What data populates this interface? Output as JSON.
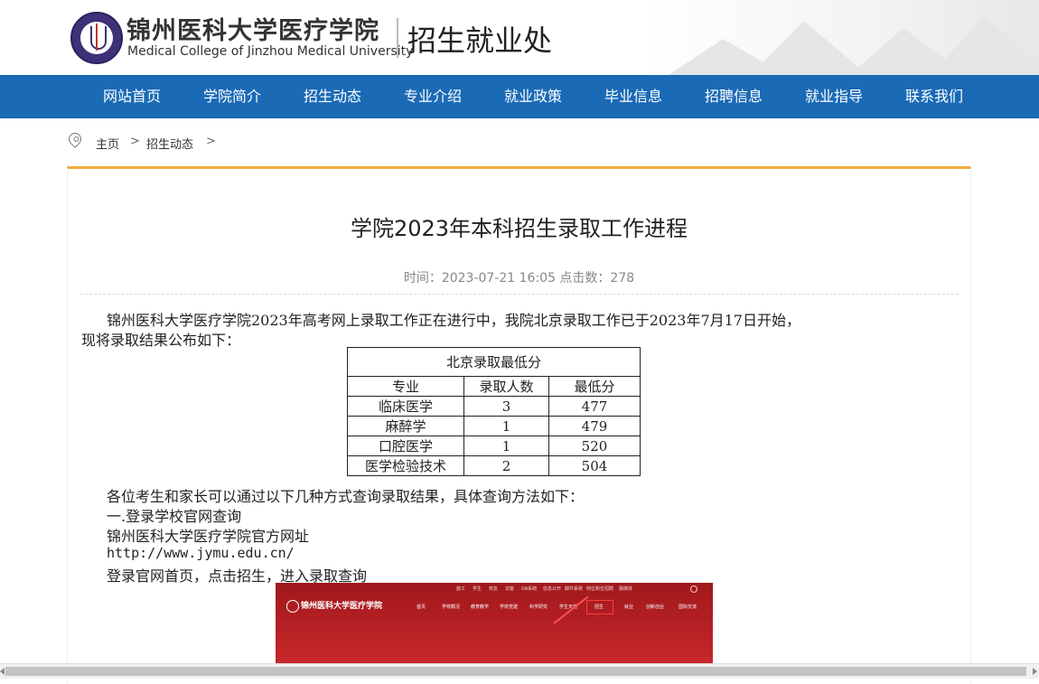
{
  "header": {
    "cn_name": "锦州医科大学医疗学院",
    "en_name": "Medical College of Jinzhou Medical University",
    "dept": "招生就业处"
  },
  "nav": {
    "items": [
      "网站首页",
      "学院简介",
      "招生动态",
      "专业介绍",
      "就业政策",
      "毕业信息",
      "招聘信息",
      "就业指导",
      "联系我们"
    ],
    "color": "#1a6ab6"
  },
  "breadcrumb": {
    "home": "主页",
    "sep": ">",
    "section": "招生动态",
    "sep2": ">"
  },
  "article": {
    "title": "学院2023年本科招生录取工作进程",
    "meta": "时间：2023-07-21 16:05 点击数：278",
    "para1_line1": "锦州医科大学医疗学院2023年高考网上录取工作正在进行中，我院北京录取工作已于2023年7月17日开始，",
    "para1_line2": "现将录取结果公布如下：",
    "table": {
      "caption": "北京录取最低分",
      "headers": [
        "专业",
        "录取人数",
        "最低分"
      ],
      "rows": [
        [
          "临床医学",
          "3",
          "477"
        ],
        [
          "麻醉学",
          "1",
          "479"
        ],
        [
          "口腔医学",
          "1",
          "520"
        ],
        [
          "医学检验技术",
          "2",
          "504"
        ]
      ]
    },
    "para2": "各位考生和家长可以通过以下几种方式查询录取结果，具体查询方法如下：",
    "para3": "一.登录学校官网查询",
    "para4": "锦州医科大学医疗学院官方网址",
    "para5": "http://www.jymu.edu.cn/",
    "para6": "登录官网首页，点击招生，进入录取查询"
  },
  "screenshot": {
    "school_name": "锦州医科大学医疗学院",
    "top_links": [
      "施工",
      "学生",
      "校友",
      "访客",
      "OA系统",
      "信息公开",
      "邮件系统",
      "岗位和位招聘",
      "融媒体"
    ],
    "nav": [
      "首页",
      "学校概况",
      "教育教学",
      "学校党建",
      "科学研究",
      "学生天地",
      "招生",
      "就业",
      "创新创业",
      "国际交流"
    ]
  }
}
